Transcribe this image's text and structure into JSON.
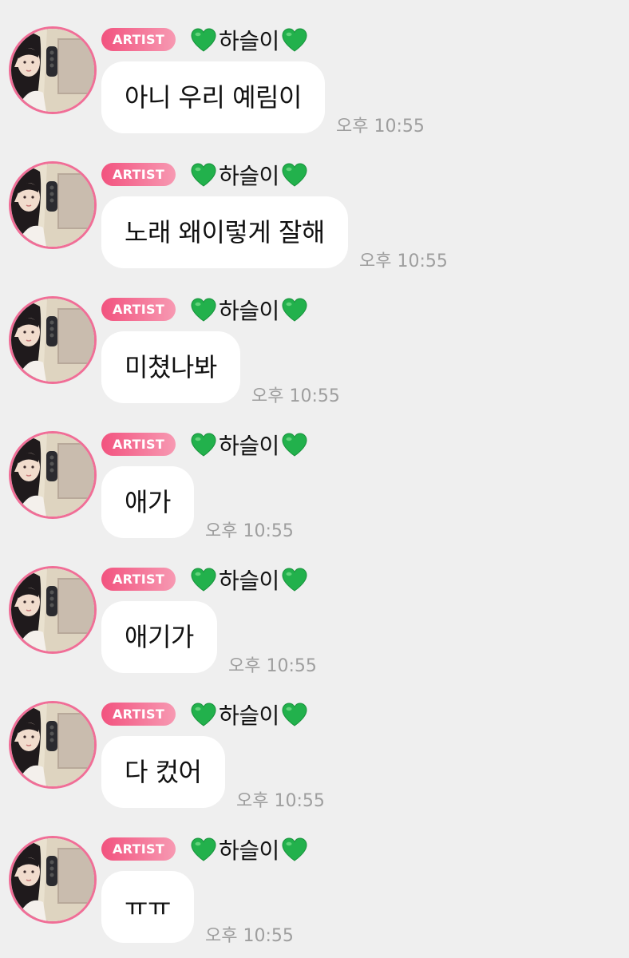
{
  "colors": {
    "background": "#efefef",
    "bubble": "#ffffff",
    "artist_badge": "#f2537f",
    "avatar_ring": "#f06e97",
    "heart": "#22b14c",
    "time_text": "#9e9e9e"
  },
  "messages": [
    {
      "badge": "ARTIST",
      "heart_left": "green-heart-icon",
      "nickname": "하슬이",
      "heart_right": "green-heart-icon",
      "text": "아니 우리 예림이",
      "time": "오후 10:55"
    },
    {
      "badge": "ARTIST",
      "heart_left": "green-heart-icon",
      "nickname": "하슬이",
      "heart_right": "green-heart-icon",
      "text": "노래 왜이렇게 잘해",
      "time": "오후 10:55"
    },
    {
      "badge": "ARTIST",
      "heart_left": "green-heart-icon",
      "nickname": "하슬이",
      "heart_right": "green-heart-icon",
      "text": "미쳤나봐",
      "time": "오후 10:55"
    },
    {
      "badge": "ARTIST",
      "heart_left": "green-heart-icon",
      "nickname": "하슬이",
      "heart_right": "green-heart-icon",
      "text": "애가",
      "time": "오후 10:55"
    },
    {
      "badge": "ARTIST",
      "heart_left": "green-heart-icon",
      "nickname": "하슬이",
      "heart_right": "green-heart-icon",
      "text": "애기가",
      "time": "오후 10:55"
    },
    {
      "badge": "ARTIST",
      "heart_left": "green-heart-icon",
      "nickname": "하슬이",
      "heart_right": "green-heart-icon",
      "text": "다 컸어",
      "time": "오후 10:55"
    },
    {
      "badge": "ARTIST",
      "heart_left": "green-heart-icon",
      "nickname": "하슬이",
      "heart_right": "green-heart-icon",
      "text": "ㅠㅠ",
      "time": "오후 10:55"
    }
  ]
}
